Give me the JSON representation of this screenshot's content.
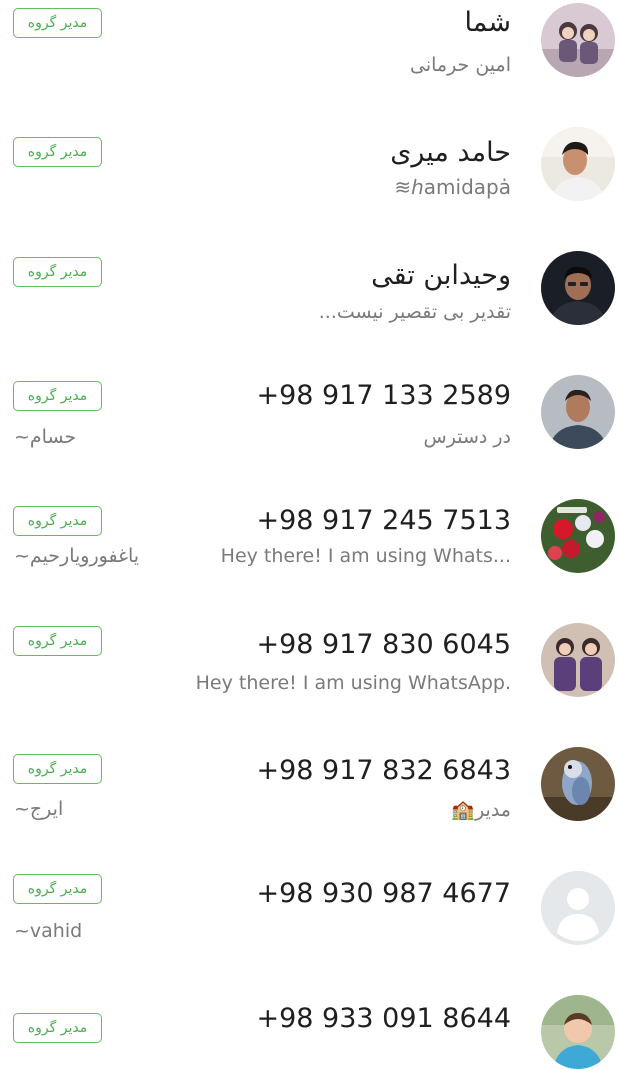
{
  "participants": [
    {
      "name": "شما",
      "about": "امین حرمانی",
      "pushname": "",
      "badge": "مدیر گروه",
      "avatar": "kids-photo-avatar"
    },
    {
      "name": "حامد میری",
      "about": "ℎamidapȧ≋",
      "pushname": "",
      "badge": "مدیر گروه",
      "avatar": "man-photo-avatar"
    },
    {
      "name": "وحیدابن تقی",
      "about": "تقدیر بی تقصیر نیست...",
      "pushname": "",
      "badge": "مدیر گروه",
      "avatar": "dark-photo-avatar"
    },
    {
      "name": "+98 917 133 2589",
      "about": "در دسترس",
      "pushname": "~حسام",
      "badge": "مدیر گروه",
      "avatar": "man-photo-avatar"
    },
    {
      "name": "+98 917 245 7513",
      "about": "Hey there! I am using Whats...",
      "pushname": "~یاغفورویارحیم",
      "badge": "مدیر گروه",
      "avatar": "flowers-photo-avatar"
    },
    {
      "name": "+98 917 830 6045",
      "about": "Hey there! I am using WhatsApp.",
      "pushname": "",
      "badge": "مدیر گروه",
      "avatar": "kids-photo-avatar"
    },
    {
      "name": "+98 917 832 6843",
      "about": "مدیر🏫",
      "pushname": "~ایرج",
      "badge": "مدیر گروه",
      "avatar": "bird-photo-avatar"
    },
    {
      "name": "+98 930 987 4677",
      "about": "",
      "pushname": "~vahid",
      "badge": "مدیر گروه",
      "avatar": "default-person-avatar"
    },
    {
      "name": "+98 933 091 8644",
      "about": "",
      "pushname": "",
      "badge": "مدیر گروه",
      "avatar": "child-photo-avatar"
    }
  ]
}
